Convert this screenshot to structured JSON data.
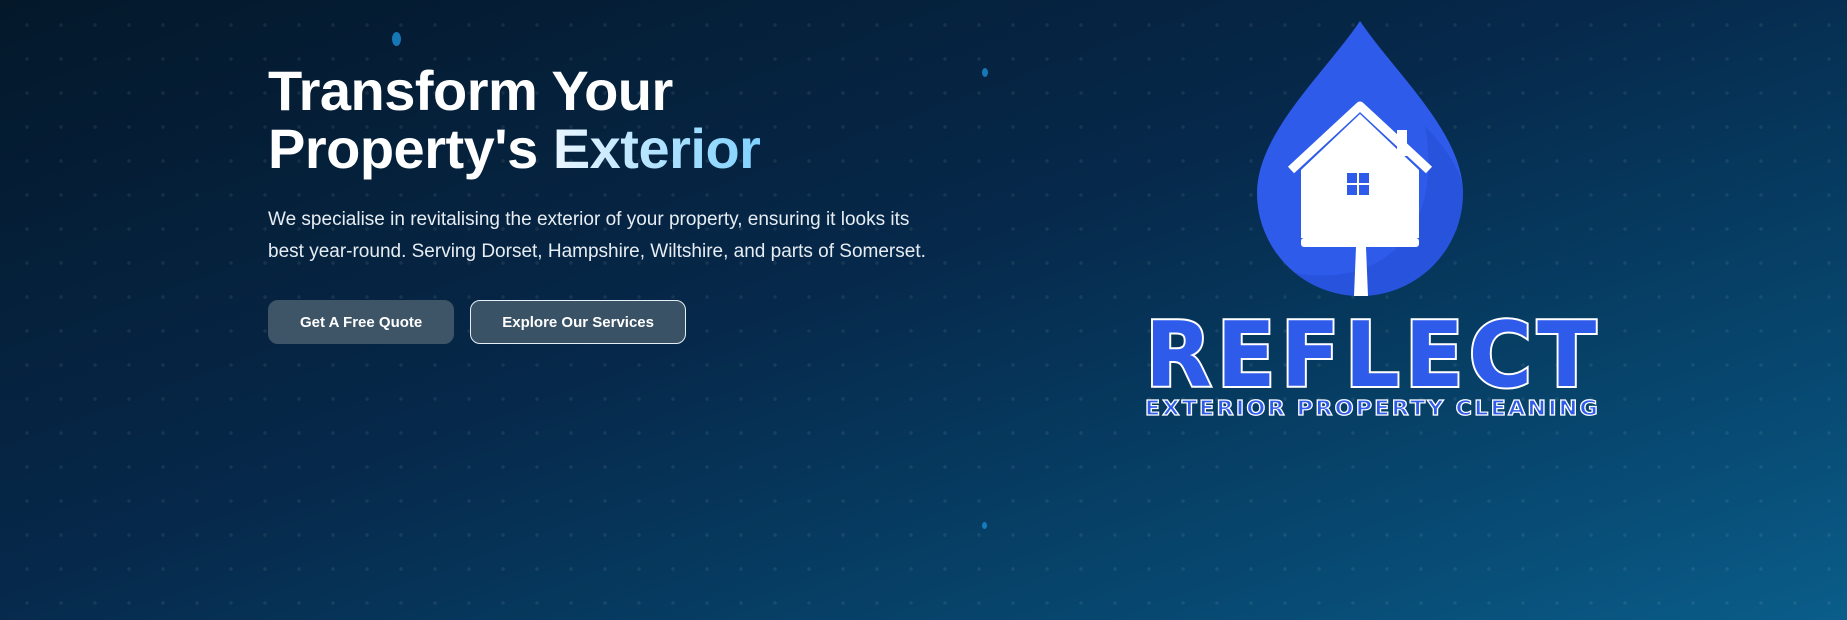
{
  "hero": {
    "title_line1": "Transform Your",
    "title_line2_plain": "Property's ",
    "title_line2_accent": "Exterior",
    "description": "We specialise in revitalising the exterior of your property, ensuring it looks its best year-round. Serving Dorset, Hampshire, Wiltshire, and parts of Somerset.",
    "primary_button": "Get A Free Quote",
    "secondary_button": "Explore Our Services"
  },
  "logo": {
    "brand_name": "REFLECT",
    "tagline": "EXTERIOR PROPERTY CLEANING",
    "icon": "house-droplet-icon"
  },
  "colors": {
    "background_dark": "#04182a",
    "background_light": "#0a5d8a",
    "logo_blue": "#2f5bea",
    "accent_gradient_end": "#7fd2ff",
    "button_fill": "#3e5568"
  }
}
